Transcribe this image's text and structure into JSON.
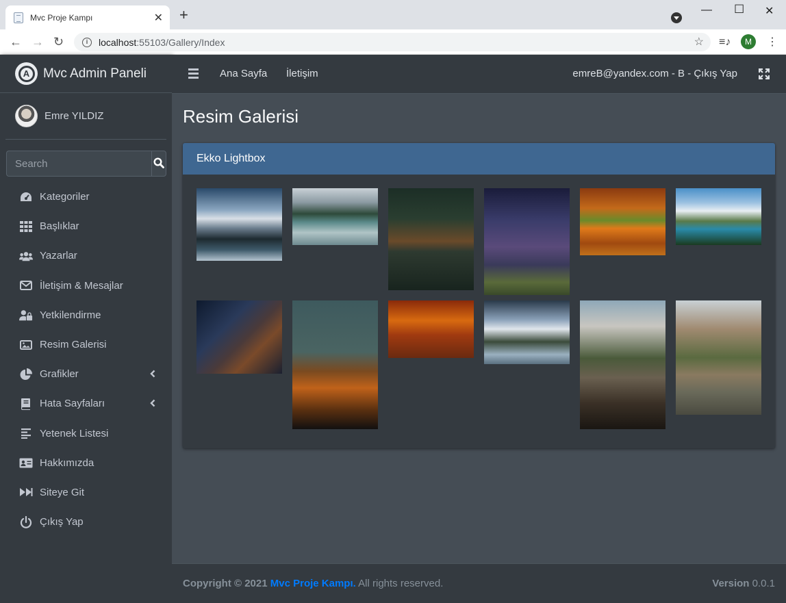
{
  "browser": {
    "tab_title": "Mvc Proje Kampı",
    "url_host": "localhost",
    "url_path": ":55103/Gallery/Index",
    "profile_initial": "M"
  },
  "sidebar": {
    "brand": "Mvc Admin Paneli",
    "user_name": "Emre YILDIZ",
    "search_placeholder": "Search",
    "items": [
      {
        "label": "Kategoriler",
        "icon": "tachometer-icon"
      },
      {
        "label": "Başlıklar",
        "icon": "grid-icon"
      },
      {
        "label": "Yazarlar",
        "icon": "users-icon"
      },
      {
        "label": "İletişim & Mesajlar",
        "icon": "envelope-icon"
      },
      {
        "label": "Yetkilendirme",
        "icon": "user-lock-icon"
      },
      {
        "label": "Resim Galerisi",
        "icon": "image-icon"
      },
      {
        "label": "Grafikler",
        "icon": "pie-chart-icon"
      },
      {
        "label": "Hata Sayfaları",
        "icon": "book-icon"
      },
      {
        "label": "Yetenek Listesi",
        "icon": "align-left-icon"
      },
      {
        "label": "Hakkımızda",
        "icon": "id-card-icon"
      },
      {
        "label": "Siteye Git",
        "icon": "fast-forward-icon"
      },
      {
        "label": "Çıkış Yap",
        "icon": "power-icon"
      }
    ]
  },
  "topnav": {
    "home": "Ana Sayfa",
    "contact": "İletişim",
    "user_info": "emreB@yandex.com - B - Çıkış Yap"
  },
  "main": {
    "page_title": "Resim Galerisi",
    "card_title": "Ekko Lightbox",
    "gallery": [
      {
        "name": "mountain-lake-clouds"
      },
      {
        "name": "lake-island-reflection"
      },
      {
        "name": "dark-forest-lake"
      },
      {
        "name": "lighthouse-milky-way"
      },
      {
        "name": "autumn-forest-lake"
      },
      {
        "name": "alpine-lake-mountains"
      },
      {
        "name": "milky-way-rocks"
      },
      {
        "name": "moon-over-mountains"
      },
      {
        "name": "autumn-cabin"
      },
      {
        "name": "snowy-mountain-forest"
      },
      {
        "name": "valley-river-forest"
      },
      {
        "name": "yosemite-reflection"
      }
    ]
  },
  "footer": {
    "copyright": "Copyright © 2021",
    "brand": "Mvc Proje Kampı.",
    "rights": " All rights reserved.",
    "version_label": "Version",
    "version": " 0.0.1"
  }
}
